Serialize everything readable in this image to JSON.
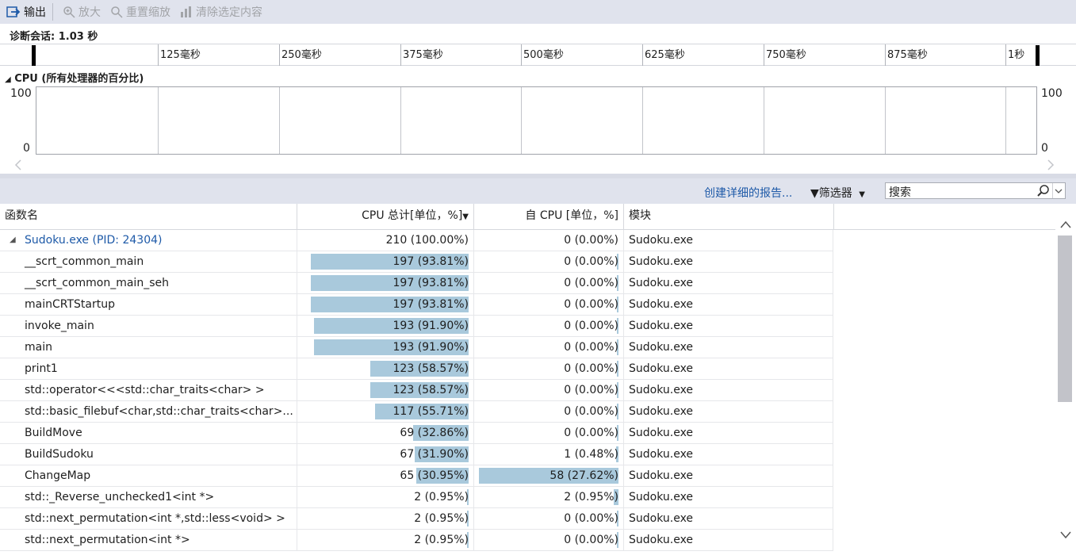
{
  "toolbar": {
    "export_label": "输出",
    "zoom_in_label": "放大",
    "reset_zoom_label": "重置缩放",
    "clear_selection_label": "清除选定内容"
  },
  "session": {
    "text": "诊断会话: 1.03 秒"
  },
  "ruler": {
    "labels": [
      "125毫秒",
      "250毫秒",
      "375毫秒",
      "500毫秒",
      "625毫秒",
      "750毫秒",
      "875毫秒",
      "1秒"
    ]
  },
  "cpu_panel": {
    "title": "CPU (所有处理器的百分比)",
    "y_max": "100",
    "y_min": "0"
  },
  "grid_toolbar": {
    "report_link": "创建详细的报告...",
    "filter_label": "筛选器",
    "search_value": "搜索"
  },
  "columns": [
    "函数名",
    "CPU 总计[单位，%]",
    "自 CPU [单位，%]",
    "模块"
  ],
  "rows": [
    {
      "name": "Sudoku.exe (PID: 24304)",
      "total": "210 (100.00%)",
      "total_pct": 100.0,
      "self": "0 (0.00%)",
      "self_pct": 0.0,
      "module": "Sudoku.exe"
    },
    {
      "name": "__scrt_common_main",
      "total": "197 (93.81%)",
      "total_pct": 93.81,
      "self": "0 (0.00%)",
      "self_pct": 0.0,
      "module": "Sudoku.exe"
    },
    {
      "name": "__scrt_common_main_seh",
      "total": "197 (93.81%)",
      "total_pct": 93.81,
      "self": "0 (0.00%)",
      "self_pct": 0.0,
      "module": "Sudoku.exe"
    },
    {
      "name": "mainCRTStartup",
      "total": "197 (93.81%)",
      "total_pct": 93.81,
      "self": "0 (0.00%)",
      "self_pct": 0.0,
      "module": "Sudoku.exe"
    },
    {
      "name": "invoke_main",
      "total": "193 (91.90%)",
      "total_pct": 91.9,
      "self": "0 (0.00%)",
      "self_pct": 0.0,
      "module": "Sudoku.exe"
    },
    {
      "name": "main",
      "total": "193 (91.90%)",
      "total_pct": 91.9,
      "self": "0 (0.00%)",
      "self_pct": 0.0,
      "module": "Sudoku.exe"
    },
    {
      "name": "print1",
      "total": "123 (58.57%)",
      "total_pct": 58.57,
      "self": "0 (0.00%)",
      "self_pct": 0.0,
      "module": "Sudoku.exe"
    },
    {
      "name": "std::operator<<<std::char_traits<char> >",
      "total": "123 (58.57%)",
      "total_pct": 58.57,
      "self": "0 (0.00%)",
      "self_pct": 0.0,
      "module": "Sudoku.exe"
    },
    {
      "name": "std::basic_filebuf<char,std::char_traits<char>...",
      "total": "117 (55.71%)",
      "total_pct": 55.71,
      "self": "0 (0.00%)",
      "self_pct": 0.0,
      "module": "Sudoku.exe"
    },
    {
      "name": "BuildMove",
      "total": "69 (32.86%)",
      "total_pct": 32.86,
      "self": "0 (0.00%)",
      "self_pct": 0.0,
      "module": "Sudoku.exe"
    },
    {
      "name": "BuildSudoku",
      "total": "67 (31.90%)",
      "total_pct": 31.9,
      "self": "1 (0.48%)",
      "self_pct": 0.48,
      "module": "Sudoku.exe"
    },
    {
      "name": "ChangeMap",
      "total": "65 (30.95%)",
      "total_pct": 30.95,
      "self": "58 (27.62%)",
      "self_pct": 27.62,
      "module": "Sudoku.exe"
    },
    {
      "name": "std::_Reverse_unchecked1<int *>",
      "total": "2 (0.95%)",
      "total_pct": 0.95,
      "self": "2 (0.95%)",
      "self_pct": 0.95,
      "module": "Sudoku.exe"
    },
    {
      "name": "std::next_permutation<int *,std::less<void> >",
      "total": "2 (0.95%)",
      "total_pct": 0.95,
      "self": "0 (0.00%)",
      "self_pct": 0.0,
      "module": "Sudoku.exe"
    },
    {
      "name": "std::next_permutation<int *>",
      "total": "2 (0.95%)",
      "total_pct": 0.95,
      "self": "0 (0.00%)",
      "self_pct": 0.0,
      "module": "Sudoku.exe"
    }
  ]
}
